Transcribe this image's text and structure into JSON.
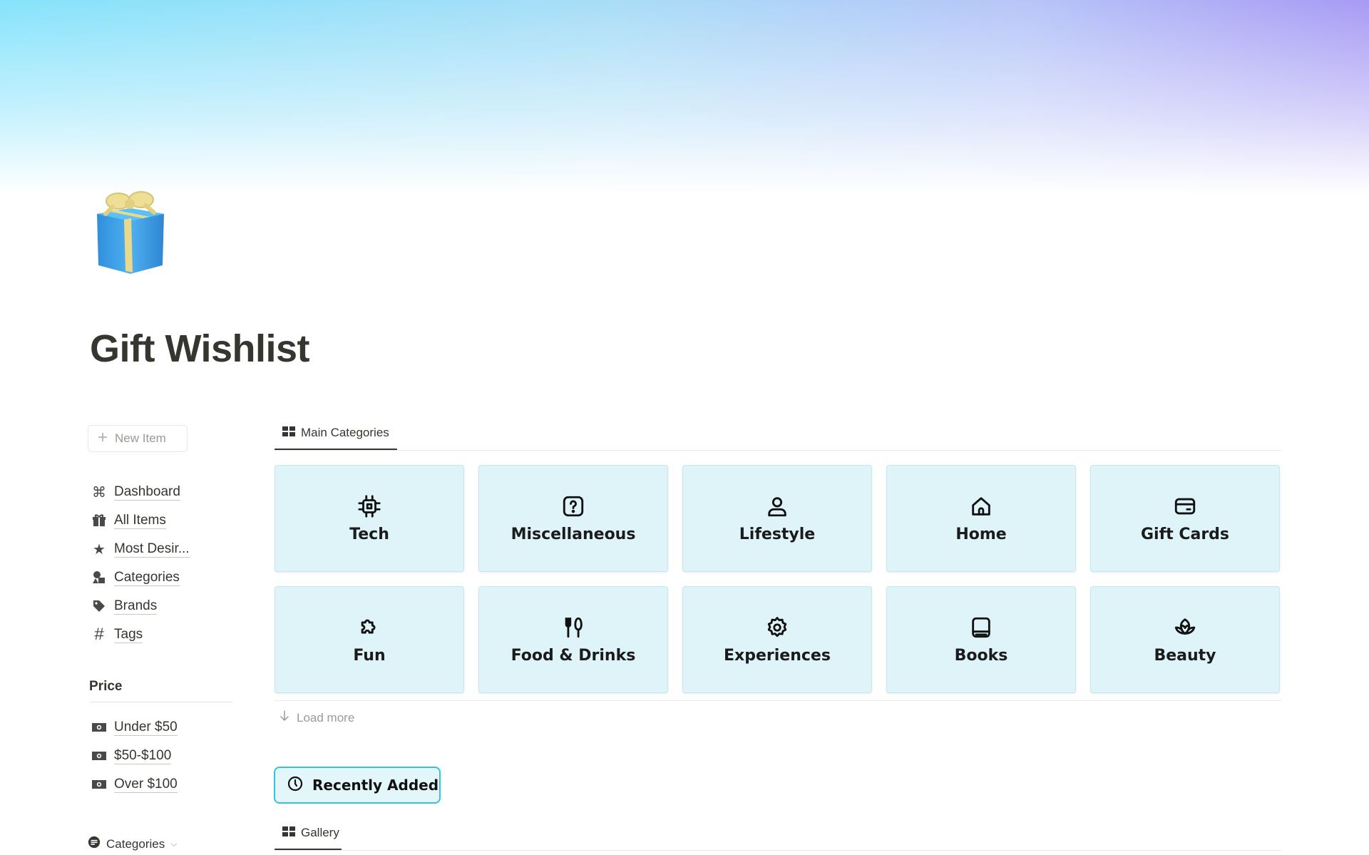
{
  "page": {
    "title": "Gift Wishlist",
    "icon": "wrapped-gift-icon"
  },
  "sidebar": {
    "new_item_label": "New Item",
    "nav": [
      {
        "label": "Dashboard",
        "icon": "command-icon"
      },
      {
        "label": "All Items",
        "icon": "gift-icon"
      },
      {
        "label": "Most Desir...",
        "icon": "star-icon"
      },
      {
        "label": "Categories",
        "icon": "shapes-icon"
      },
      {
        "label": "Brands",
        "icon": "tag-icon"
      },
      {
        "label": "Tags",
        "icon": "hashtag-icon"
      }
    ],
    "price_heading": "Price",
    "price": [
      {
        "label": "Under $50",
        "icon": "money-icon"
      },
      {
        "label": "$50-$100",
        "icon": "money-icon"
      },
      {
        "label": "Over $100",
        "icon": "money-icon"
      }
    ],
    "categories_toggle": "Categories"
  },
  "main": {
    "categories_tab": "Main Categories",
    "categories": [
      {
        "label": "Tech",
        "icon": "chip-icon"
      },
      {
        "label": "Miscellaneous",
        "icon": "question-icon"
      },
      {
        "label": "Lifestyle",
        "icon": "person-icon"
      },
      {
        "label": "Home",
        "icon": "house-icon"
      },
      {
        "label": "Gift Cards",
        "icon": "card-icon"
      },
      {
        "label": "Fun",
        "icon": "puzzle-icon"
      },
      {
        "label": "Food & Drinks",
        "icon": "fork-knife-icon"
      },
      {
        "label": "Experiences",
        "icon": "gear-icon"
      },
      {
        "label": "Books",
        "icon": "book-icon"
      },
      {
        "label": "Beauty",
        "icon": "lotus-icon"
      }
    ],
    "load_more": "Load more",
    "recently_added": "Recently Added",
    "gallery_tab": "Gallery"
  },
  "colors": {
    "card_bg": "#def4f9",
    "accent": "#33c4d6",
    "text": "#37352f"
  }
}
